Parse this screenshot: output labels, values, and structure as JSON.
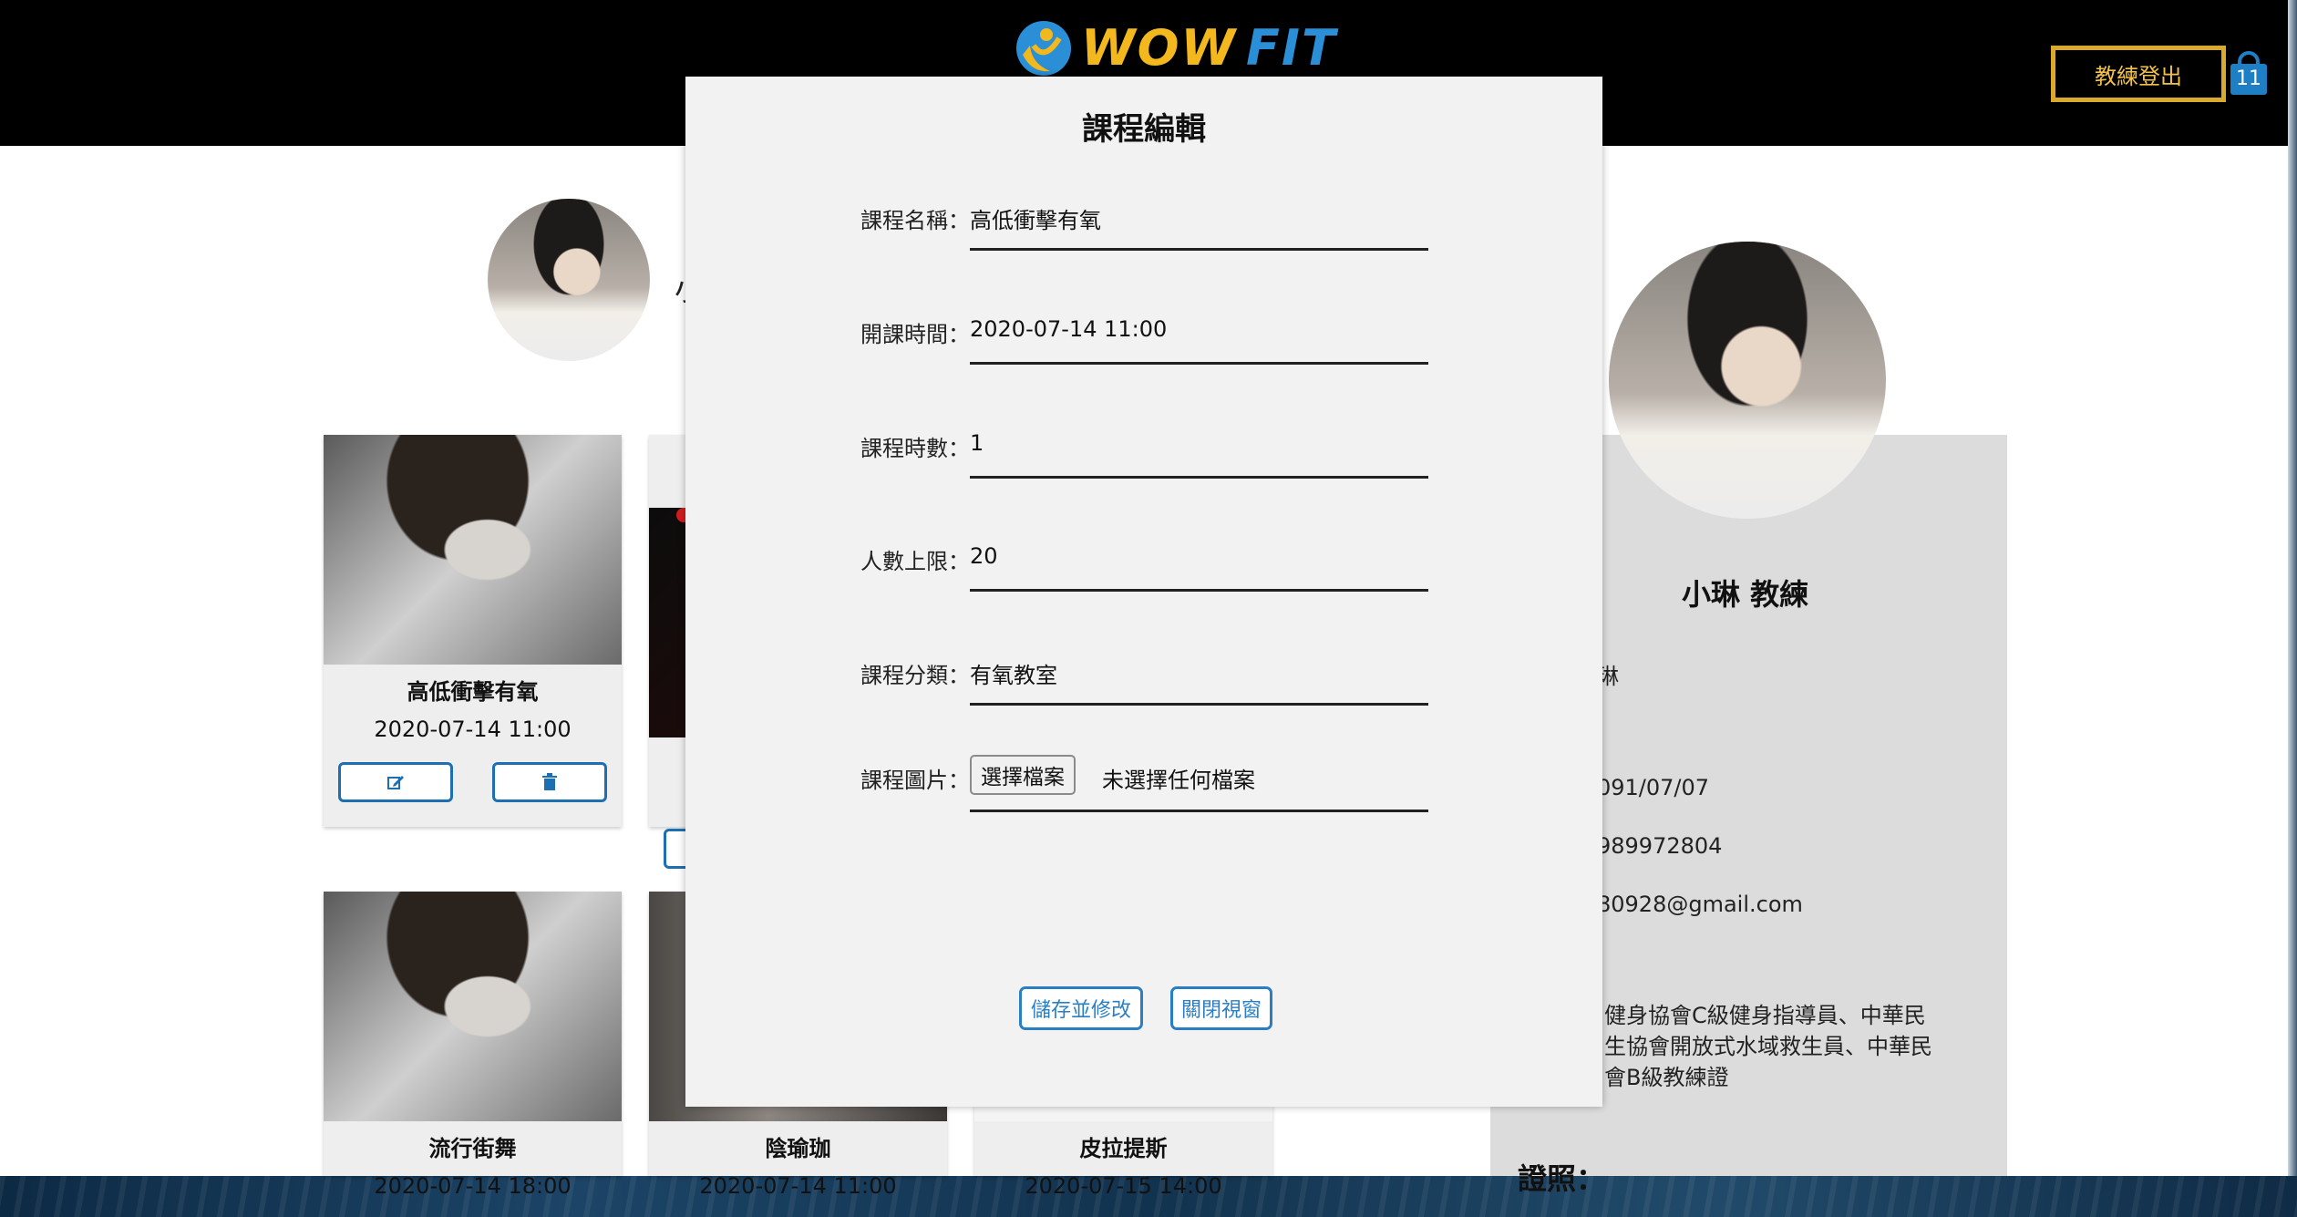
{
  "header": {
    "logo_wow": "WOW",
    "logo_fit": "FIT",
    "coach_logout_label": "教練登出",
    "cart_count": "11"
  },
  "colors": {
    "header_bg": "#000000",
    "brand_yellow": "#f2b81d",
    "brand_blue": "#2a8fd6",
    "button_blue": "#1d6fb3"
  },
  "page": {
    "name_fragment": "小",
    "courses": [
      {
        "title": "高低衝擊有氧",
        "date": "2020-07-14 11:00"
      },
      {
        "title": "流行街舞",
        "date": "2020-07-14 18:00"
      },
      {
        "title": "陰瑜珈",
        "date": "2020-07-14 11:00"
      },
      {
        "title": "皮拉提斯",
        "date": "2020-07-15 14:00"
      }
    ],
    "edit_icon": "edit-icon",
    "delete_icon": "trash-icon"
  },
  "profile": {
    "name": "小琳 教練",
    "frag_name": "琳",
    "frag_birthday": "091/07/07",
    "frag_phone": "989972804",
    "frag_email": "80928@gmail.com",
    "frag_desc1": "健身協會C級健身指導員、中華民",
    "frag_desc2": "生協會開放式水域救生員、中華民",
    "frag_desc3": "會B級教練證",
    "cert_heading": "證照："
  },
  "modal": {
    "title": "課程編輯",
    "fields": [
      {
        "label": "課程名稱：",
        "value": "高低衝擊有氧"
      },
      {
        "label": "開課時間：",
        "value": "2020-07-14 11:00"
      },
      {
        "label": "課程時數：",
        "value": "1"
      },
      {
        "label": "人數上限：",
        "value": "20"
      },
      {
        "label": "課程分類：",
        "value": "有氧教室"
      }
    ],
    "image_label": "課程圖片：",
    "file_button": "選擇檔案",
    "file_status": "未選擇任何檔案",
    "save_button": "儲存並修改",
    "close_button": "關閉視窗"
  }
}
